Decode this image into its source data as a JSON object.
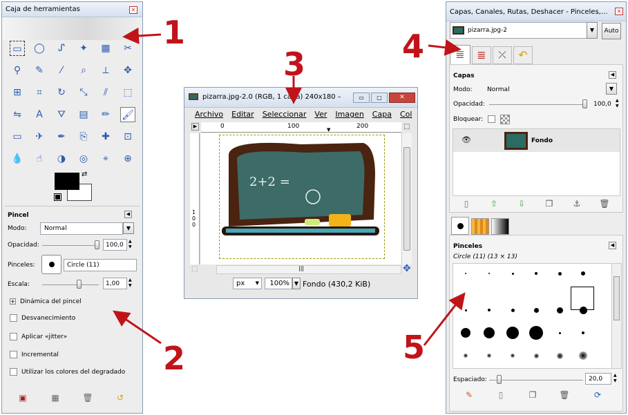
{
  "toolbox": {
    "title": "Caja de herramientas",
    "close": "✕",
    "fg_color": "#000000",
    "bg_color": "#ffffff",
    "tools": [
      "rect-select",
      "ellipse-select",
      "lasso",
      "fuzzy-select",
      "select-by-color",
      "scissors",
      "foreground-select",
      "paths",
      "color-picker",
      "zoom",
      "measure",
      "move",
      "align",
      "crop",
      "rotate",
      "scale",
      "shear",
      "perspective",
      "flip",
      "text",
      "bucket-fill",
      "blend",
      "pencil",
      "paintbrush",
      "eraser",
      "airbrush",
      "ink",
      "clone",
      "heal",
      "perspective-clone",
      "blur",
      "smudge",
      "dodge-burn",
      "cage",
      "warp",
      "unified-transform"
    ],
    "options": {
      "title": "Pincel",
      "mode_label": "Modo:",
      "mode_value": "Normal",
      "opacity_label": "Opacidad:",
      "opacity_value": "100,0",
      "brush_label": "Pinceles:",
      "brush_value": "Circle (11)",
      "scale_label": "Escala:",
      "scale_value": "1,00",
      "dynamics": "Dinámica del pincel",
      "fade": "Desvanecimiento",
      "jitter": "Aplicar «jitter»",
      "incremental": "Incremental",
      "gradient": "Utilizar los colores del degradado"
    }
  },
  "image_window": {
    "title": "pizarra.jpg-2.0 (RGB, 1 capa) 240x180 –...",
    "menu": [
      "Archivo",
      "Editar",
      "Seleccionar",
      "Ver",
      "Imagen",
      "Capa",
      "Col"
    ],
    "ruler": [
      "0",
      "100",
      "200"
    ],
    "vruler": "100",
    "unit": "px",
    "zoom": "100%",
    "status": "Fondo (430,2 KiB)",
    "board_text": "2+2 ="
  },
  "dock": {
    "title": "Capas, Canales, Rutas, Deshacer - Pinceles,...",
    "image_select": "pizarra.jpg-2",
    "auto": "Auto",
    "layers": {
      "title": "Capas",
      "mode_label": "Modo:",
      "mode_value": "Normal",
      "opacity_label": "Opacidad:",
      "opacity_value": "100,0",
      "lock_label": "Bloquear:",
      "layer_name": "Fondo"
    },
    "brushes": {
      "title": "Pinceles",
      "current": "Circle (11) (13 × 13)",
      "spacing_label": "Espaciado:",
      "spacing_value": "20,0"
    }
  },
  "annotations": {
    "n1": "1",
    "n2": "2",
    "n3": "3",
    "n4": "4",
    "n5": "5",
    "arrow_color": "#c0141a"
  }
}
